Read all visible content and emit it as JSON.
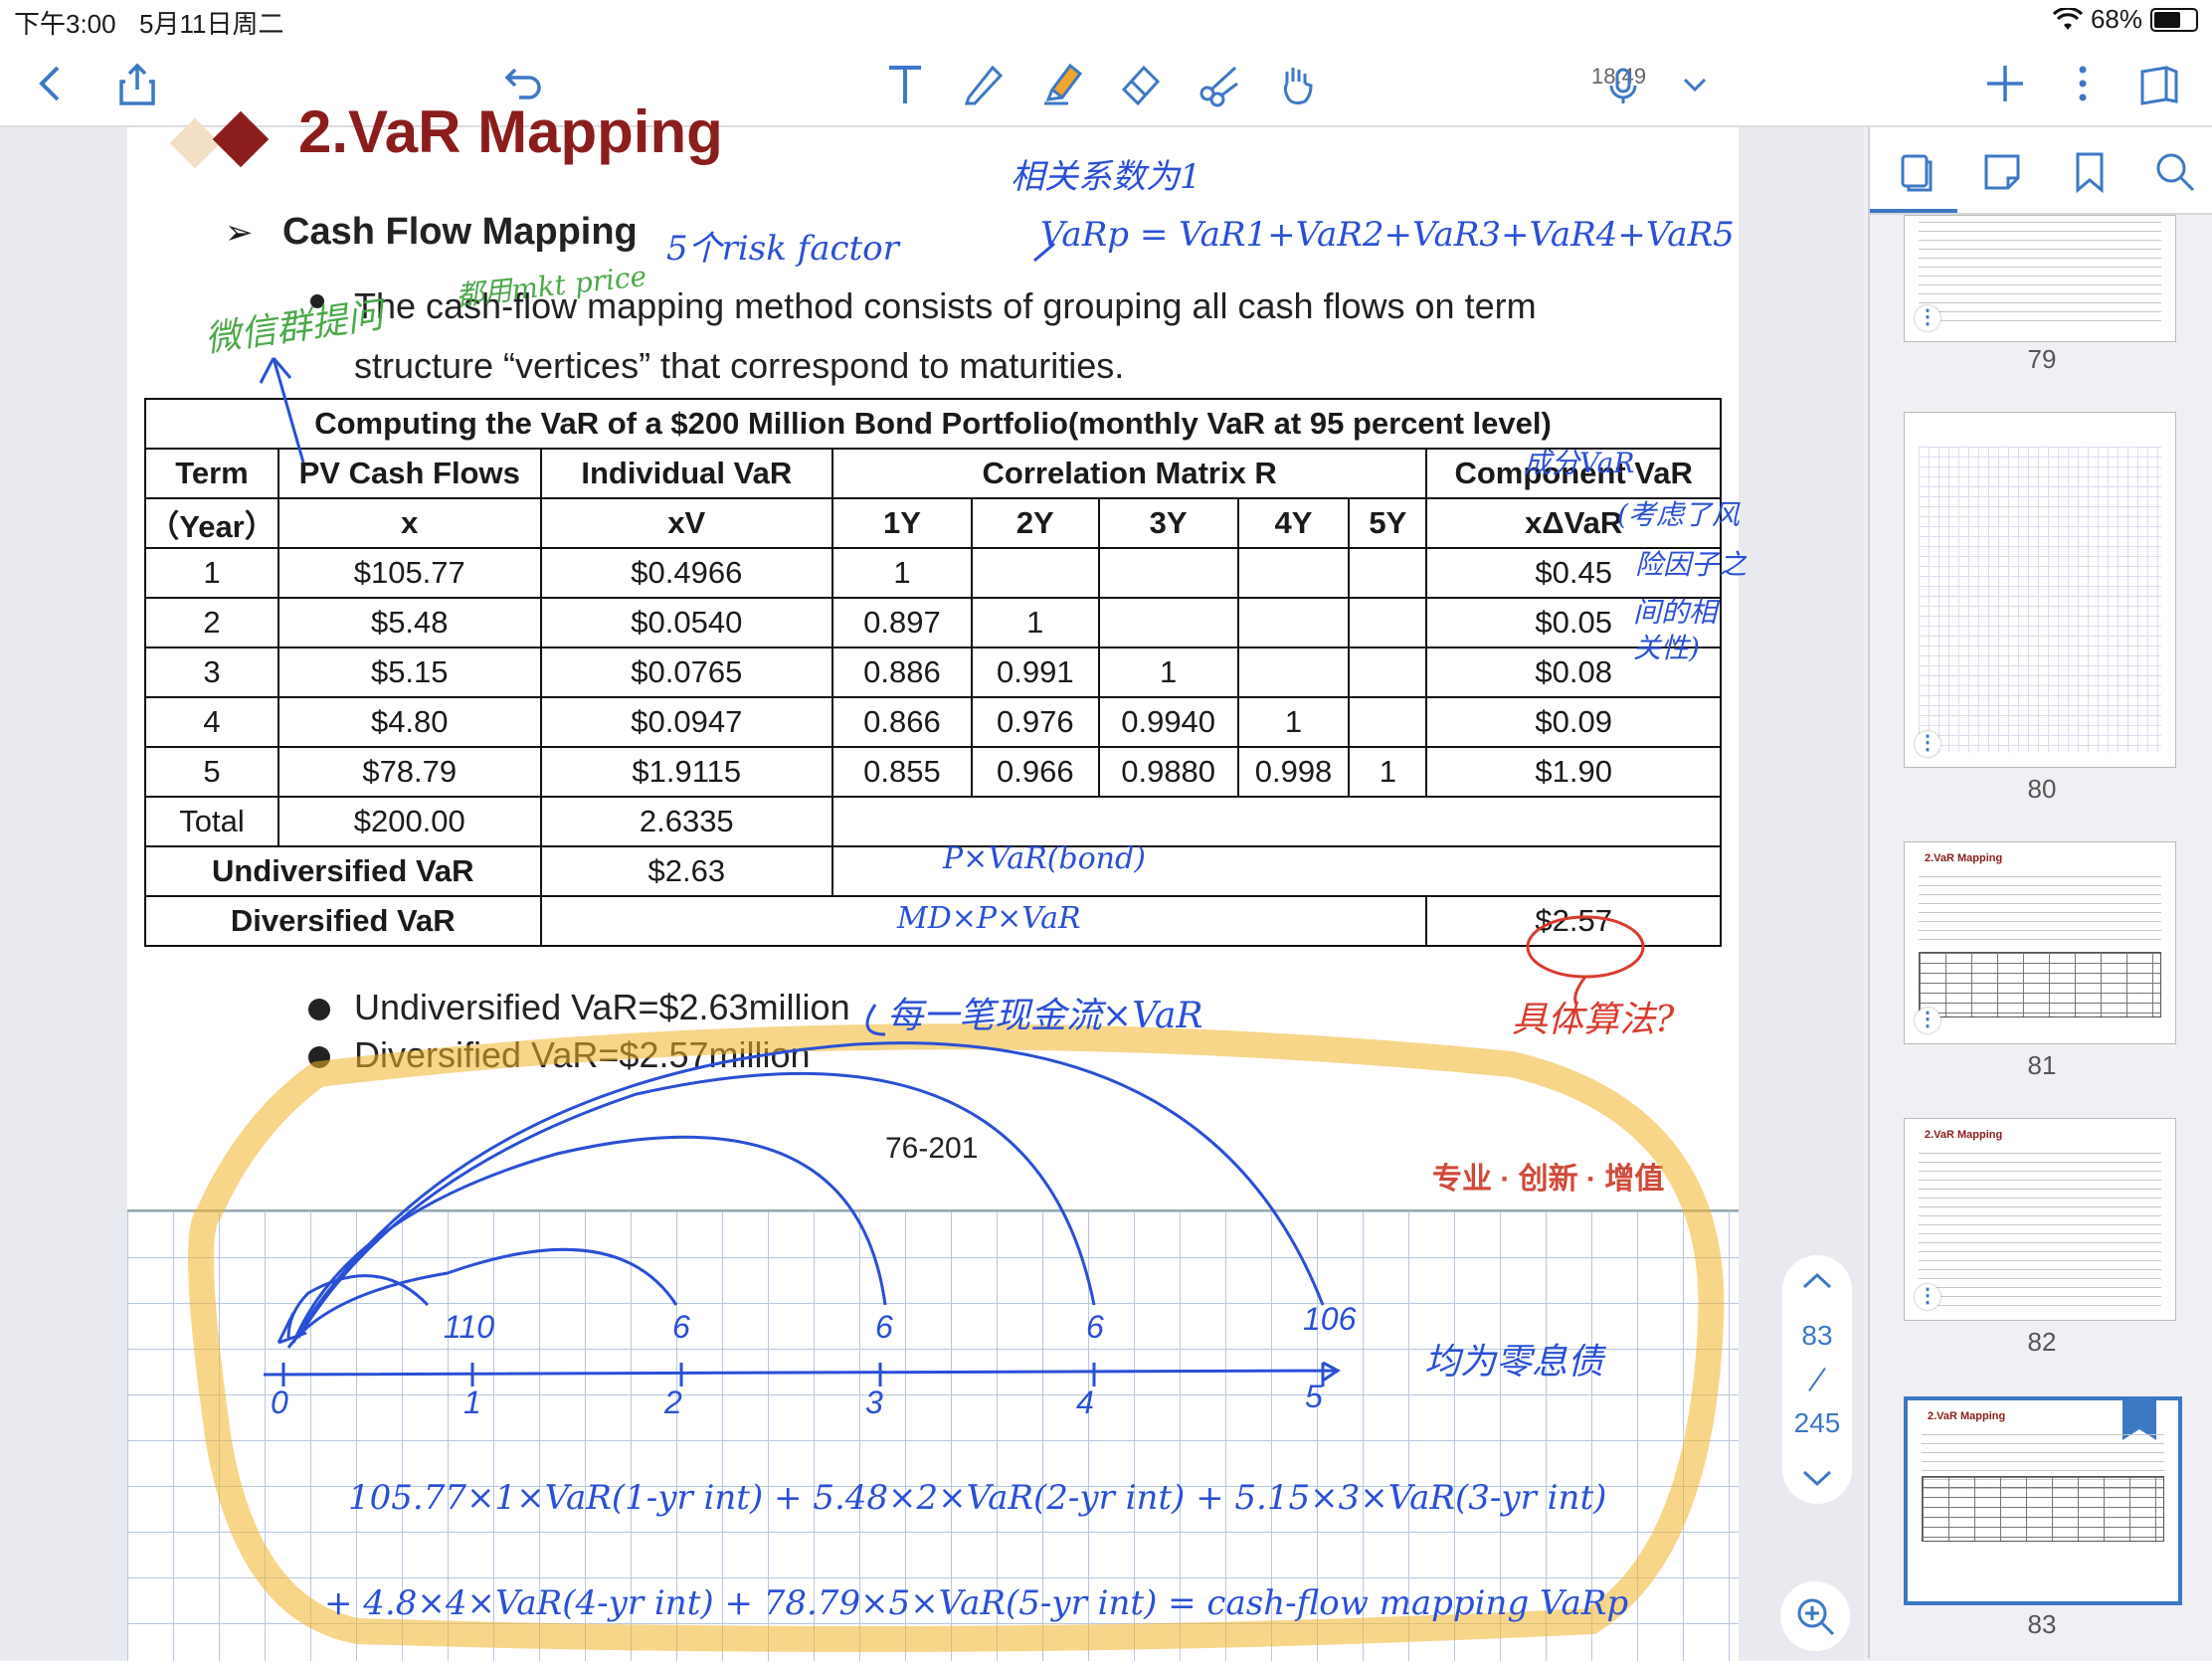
{
  "status_bar": {
    "time": "下午3:00",
    "date": "5月11日周二",
    "wifi": "wifi-icon",
    "battery": "68%"
  },
  "toolbar": {
    "record_time": "18:49"
  },
  "slide": {
    "title": "2.VaR Mapping",
    "subtitle": "Cash Flow Mapping",
    "body": "The cash-flow mapping method consists of grouping all cash flows on term structure “vertices” that correspond to maturities.",
    "table": {
      "caption": "Computing the VaR of a $200 Million Bond Portfolio(monthly VaR at 95 percent level)",
      "h1": {
        "term": "Term",
        "pv": "PV Cash Flows",
        "ivar": "Individual VaR",
        "corr": "Correlation Matrix R",
        "cvar": "Component VaR"
      },
      "h2": {
        "year": "（Year）",
        "x": "x",
        "xv": "xV",
        "c1": "1Y",
        "c2": "2Y",
        "c3": "3Y",
        "c4": "4Y",
        "c5": "5Y",
        "xdv": "xΔVaR"
      },
      "rows": [
        {
          "term": "1",
          "pv": "$105.77",
          "ivar": "$0.4966",
          "c1": "1",
          "c2": "",
          "c3": "",
          "c4": "",
          "c5": "",
          "cvar": "$0.45"
        },
        {
          "term": "2",
          "pv": "$5.48",
          "ivar": "$0.0540",
          "c1": "0.897",
          "c2": "1",
          "c3": "",
          "c4": "",
          "c5": "",
          "cvar": "$0.05"
        },
        {
          "term": "3",
          "pv": "$5.15",
          "ivar": "$0.0765",
          "c1": "0.886",
          "c2": "0.991",
          "c3": "1",
          "c4": "",
          "c5": "",
          "cvar": "$0.08"
        },
        {
          "term": "4",
          "pv": "$4.80",
          "ivar": "$0.0947",
          "c1": "0.866",
          "c2": "0.976",
          "c3": "0.9940",
          "c4": "1",
          "c5": "",
          "cvar": "$0.09"
        },
        {
          "term": "5",
          "pv": "$78.79",
          "ivar": "$1.9115",
          "c1": "0.855",
          "c2": "0.966",
          "c3": "0.9880",
          "c4": "0.998",
          "c5": "1",
          "cvar": "$1.90"
        }
      ],
      "total": {
        "label": "Total",
        "pv": "$200.00",
        "ivar": "2.6335"
      },
      "undiv": {
        "label": "Undiversified VaR",
        "value": "$2.63"
      },
      "div": {
        "label": "Diversified VaR",
        "value": "$2.57"
      }
    },
    "bullets": [
      "Undiversified VaR=$2.63million",
      "Diversified VaR=$2.57million"
    ],
    "page_number": "76-201",
    "footer": "专业 · 创新 · 增值"
  },
  "notes": {
    "corr_note": "相关系数为1",
    "risk_factors": "5个risk factor",
    "varp_eq": "VaRp = VaR1+VaR2+VaR3+VaR4+VaR5",
    "mkt_price": "都用mkt price",
    "wechat": "微信群提问",
    "component_note": [
      "成分VaR",
      "(考虑了风",
      "险因子之",
      "间的相",
      "关性)"
    ],
    "px_var": "P×VaR(bond)",
    "md_var": "MD×P×VaR",
    "how": "具体算法?",
    "each_cf": "每一笔现金流×VaR",
    "zero_coupon": "均为零息债",
    "axis_points": [
      "0",
      "1",
      "2",
      "3",
      "4",
      "5"
    ],
    "cash_points": [
      "110",
      "6",
      "6",
      "6",
      "106"
    ],
    "formula_1": "105.77×1×VaR(1-yr int) + 5.48×2×VaR(2-yr int) + 5.15×3×VaR(3-yr int)",
    "formula_2": "+ 4.8×4×VaR(4-yr int) + 78.79×5×VaR(5-yr int) = cash-flow mapping VaRp"
  },
  "page_nav": {
    "current": "83",
    "total": "245"
  },
  "sidebar": {
    "thumbnails": [
      {
        "num": "79",
        "title": ""
      },
      {
        "num": "80",
        "title": ""
      },
      {
        "num": "81",
        "title": "2.VaR Mapping"
      },
      {
        "num": "82",
        "title": "2.VaR Mapping"
      },
      {
        "num": "83",
        "title": "2.VaR Mapping"
      }
    ]
  },
  "colors": {
    "accent": "#3d78c5",
    "title": "#8b1d1d",
    "ink_blue": "#2a4fd6",
    "ink_red": "#d93a2e",
    "ink_green": "#4ca84a",
    "highlighter": "#f0b429"
  }
}
